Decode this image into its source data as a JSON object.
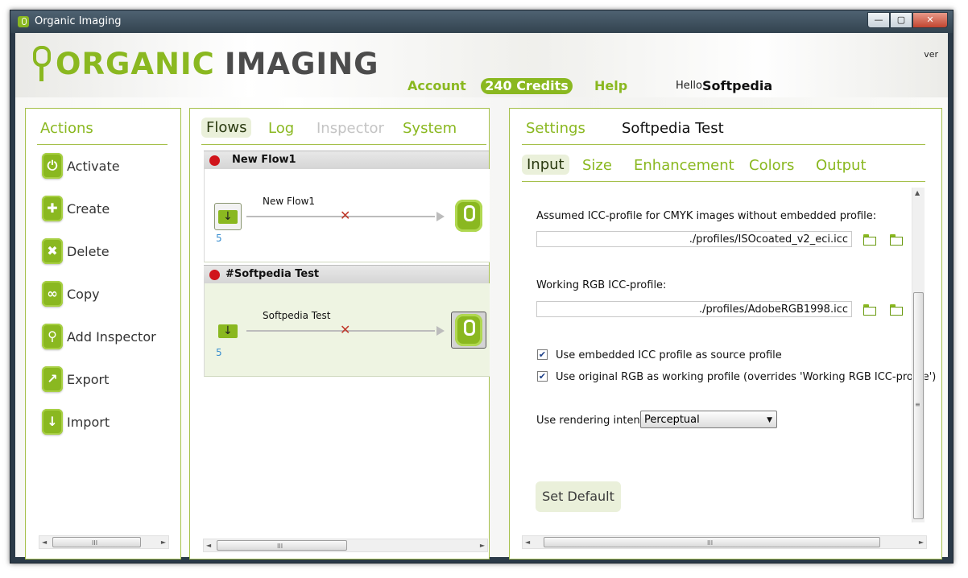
{
  "window": {
    "title": "Organic Imaging",
    "controls": {
      "minimize": "—",
      "maximize": "▢",
      "close": "✕"
    }
  },
  "header": {
    "logo_organic": "ORGANIC",
    "logo_imaging": "IMAGING",
    "nav": {
      "account": "Account",
      "credits": "240 Credits",
      "help": "Help"
    },
    "hello": "Hello",
    "user": "Softpedia",
    "version": "ver"
  },
  "actions": {
    "title": "Actions",
    "items": [
      {
        "label": "Activate",
        "icon": "power-icon"
      },
      {
        "label": "Create",
        "icon": "plus-icon"
      },
      {
        "label": "Delete",
        "icon": "x-icon"
      },
      {
        "label": "Copy",
        "icon": "link-icon"
      },
      {
        "label": "Add Inspector",
        "icon": "magnifier-icon"
      },
      {
        "label": "Export",
        "icon": "export-arrow-icon"
      },
      {
        "label": "Import",
        "icon": "import-arrow-icon"
      }
    ]
  },
  "flows_panel": {
    "tabs": [
      "Flows",
      "Log",
      "Inspector",
      "System"
    ],
    "active_tab": "Flows",
    "disabled_tab": "Inspector",
    "flows": [
      {
        "name": "New Flow1",
        "label": "New Flow1",
        "count": "5",
        "status_color": "#d0141b"
      },
      {
        "name": "#Softpedia Test",
        "label": "Softpedia Test",
        "count": "5",
        "status_color": "#d0141b"
      }
    ],
    "scroll_grip": "III"
  },
  "settings_panel": {
    "title": "Settings",
    "flow_name": "Softpedia Test",
    "tabs": [
      "Input",
      "Size",
      "Enhancement",
      "Colors",
      "Output"
    ],
    "active_tab": "Input",
    "cmyk_label": "Assumed ICC-profile for CMYK images without embedded profile:",
    "cmyk_value": "./profiles/ISOcoated_v2_eci.icc",
    "rgb_label": "Working RGB ICC-profile:",
    "rgb_value": "./profiles/AdobeRGB1998.icc",
    "check_embedded": "Use embedded ICC profile as source profile",
    "check_original": "Use original RGB as working profile (overrides 'Working RGB ICC-profile')",
    "intent_label": "Use rendering intent",
    "intent_value": "Perceptual",
    "set_default": "Set Default",
    "scroll_grip": "III"
  },
  "colors": {
    "accent": "#8ab820",
    "text_dark": "#222222",
    "status_red": "#d0141b"
  }
}
